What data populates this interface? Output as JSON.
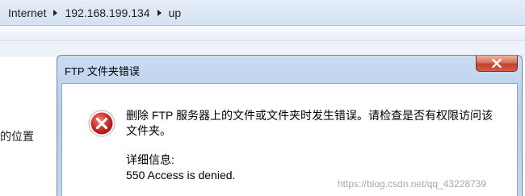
{
  "address_bar": {
    "segments": [
      "Internet",
      "192.168.199.134",
      "up"
    ],
    "separator_icon": "chevron-right-icon"
  },
  "left_pane": {
    "partial_label": "的位置"
  },
  "dialog": {
    "title": "FTP 文件夹错误",
    "close_icon": "close-icon",
    "status_icon": "error-icon",
    "message_lines": [
      "删除 FTP 服务器上的文件或文件夹时发生错误。请检查是否有权限访问该",
      "文件夹。"
    ],
    "details_label": "详细信息:",
    "details_text": "550 Access is denied."
  },
  "watermark": "https://blog.csdn.net/qq_43228739",
  "colors": {
    "title_bar": "#b8cfea",
    "close_button": "#c2412a",
    "error_icon": "#d0312d",
    "address_bar": "#d4e1f2"
  }
}
